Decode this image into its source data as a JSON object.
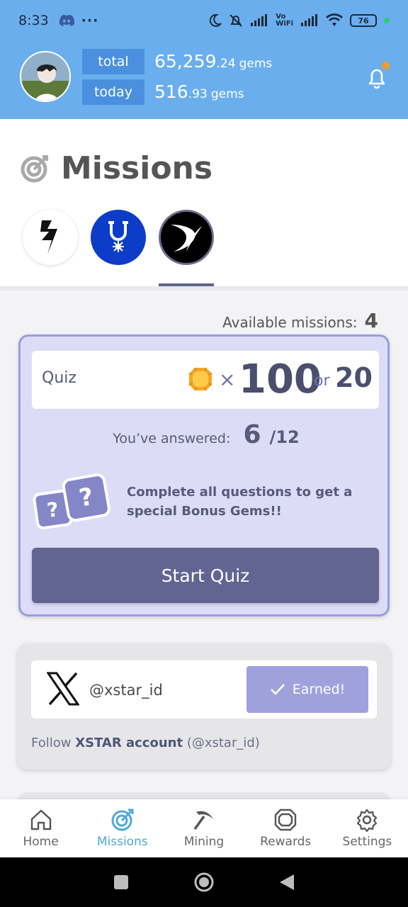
{
  "status_bar": {
    "time": "8:33",
    "battery": "76"
  },
  "header": {
    "total_label": "total",
    "total_int": "65,259",
    "total_dec": ".24",
    "total_unit": "gems",
    "today_label": "today",
    "today_int": "516",
    "today_dec": ".93",
    "today_unit": "gems"
  },
  "missions": {
    "title": "Missions",
    "available_label": "Available missions:",
    "available_count": "4"
  },
  "quiz": {
    "label": "Quiz",
    "times": "×",
    "reward": "100",
    "or_label": "or",
    "alt_reward": "20",
    "answered_label": "You’ve answered:",
    "answered_count": "6",
    "answered_total": "/12",
    "bonus_text": "Complete all questions to get a special Bonus Gems!!",
    "start_button": "Start Quiz"
  },
  "x_mission": {
    "handle": "@xstar_id",
    "earned_label": "Earned!",
    "follow_prefix": "Follow",
    "follow_bold": "XSTAR account",
    "follow_suffix": "(@xstar_id)"
  },
  "nav": {
    "items": [
      {
        "label": "Home",
        "icon": "home-icon"
      },
      {
        "label": "Missions",
        "icon": "target-icon"
      },
      {
        "label": "Mining",
        "icon": "pickaxe-icon"
      },
      {
        "label": "Rewards",
        "icon": "gem-icon"
      },
      {
        "label": "Settings",
        "icon": "gear-icon"
      }
    ],
    "active": "Missions"
  },
  "colors": {
    "header_bg": "#6aaeee",
    "pill_bg": "#4a90df",
    "accent_active": "#4ea9d8",
    "quiz_card_bg": "#dcdcf6",
    "start_button_bg": "#626591",
    "earned_bg": "#9ea1dc"
  }
}
